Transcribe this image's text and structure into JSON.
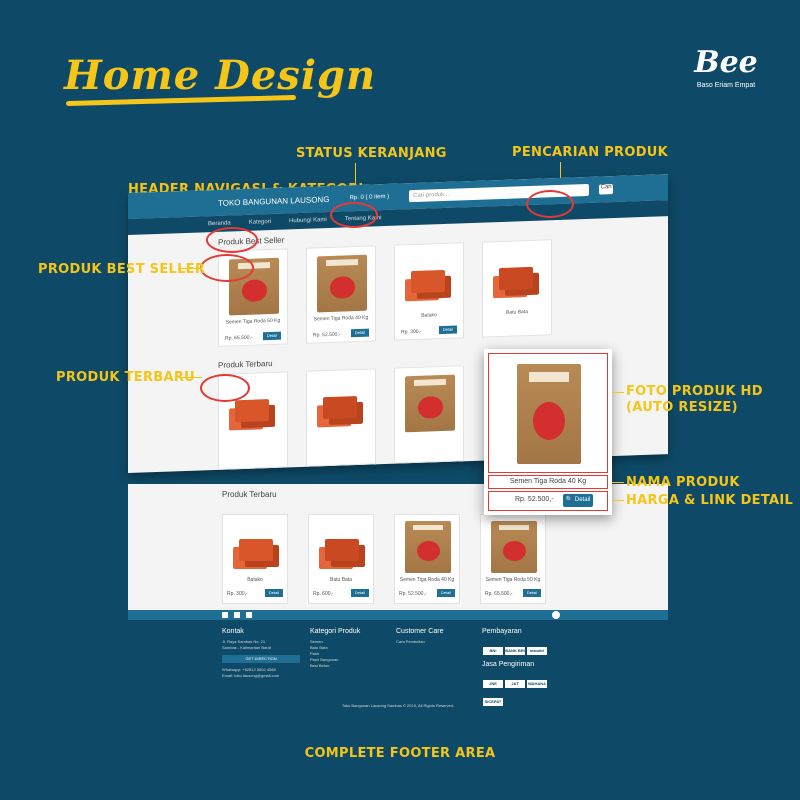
{
  "header": {
    "title": "Home Design",
    "logo_text": "Bee",
    "logo_sub": "Baso Eriam Empat"
  },
  "callouts": {
    "status_keranjang": "STATUS KERANJANG",
    "pencarian_produk": "PENCARIAN PRODUK",
    "header_navigasi": "HEADER NAVIGASI & KATEGORI",
    "produk_best_seller": "PRODUK BEST SELLER",
    "produk_terbaru": "PRODUK TERBARU",
    "foto_produk_hd": "FOTO PRODUK HD",
    "auto_resize": "(AUTO RESIZE)",
    "nama_produk": "NAMA PRODUK",
    "harga_link": "HARGA & LINK DETAIL",
    "footer_area": "COMPLETE FOOTER AREA"
  },
  "mock": {
    "store_name": "TOKO BANGUNAN LAUSONG",
    "cart": "Rp. 0 ( 0 item )",
    "search_placeholder": "Cari produk...",
    "search_button": "Cari",
    "nav": [
      "Beranda",
      "Kategori",
      "Hubungi Kami",
      "Tentang Kami"
    ],
    "best_seller_title": "Produk Best Seller",
    "terbaru_title": "Produk Terbaru",
    "best_sellers": [
      {
        "name": "Semen Tiga Roda 50 Kg",
        "price": "Rp. 65.500,-",
        "kind": "bag"
      },
      {
        "name": "Semen Tiga Roda 40 Kg",
        "price": "Rp. 52.500,-",
        "kind": "bag"
      },
      {
        "name": "Batako",
        "price": "Rp. 300,-",
        "kind": "brick"
      },
      {
        "name": "Batu Bata",
        "price": "",
        "kind": "brick"
      }
    ],
    "terbaru_cards": [
      {
        "name": "Batako",
        "price": "Rp. 300,-",
        "kind": "brick"
      },
      {
        "name": "Batu Bata",
        "price": "Rp. 600,-",
        "kind": "brick"
      },
      {
        "name": "Semen Tiga Roda 40 Kg",
        "price": "Rp. 52.500,-",
        "kind": "bag"
      },
      {
        "name": "Semen Tiga Roda 50 Kg",
        "price": "Rp. 65.500,-",
        "kind": "bag"
      }
    ],
    "detail_label": "Detail"
  },
  "zoom": {
    "name": "Semen Tiga Roda 40 Kg",
    "price": "Rp. 52.500,-",
    "detail": "Detail"
  },
  "footer": {
    "kontak_title": "Kontak",
    "address": "Jl. Raya Sambas No. 21",
    "city": "Sambas - Kalimantan Barat",
    "get_direction": "GET DIRECTION",
    "whatsapp": "Whatsapp: +62812 5602 4088",
    "email": "Email: toko.lausong@gmail.com",
    "kategori_title": "Kategori Produk",
    "kategori_items": [
      "Semen",
      "Batu Bata",
      "Pasir",
      "Pasir Bangunan",
      "Besi Beton"
    ],
    "care_title": "Customer Care",
    "care_items": [
      "Cara Pembelian"
    ],
    "pembayaran_title": "Pembayaran",
    "payments": [
      "BNI",
      "BANK BRI",
      "mandiri"
    ],
    "pengiriman_title": "Jasa Pengiriman",
    "couriers": [
      "JNE",
      "J&T",
      "WAHANA",
      "SICEPAT"
    ],
    "copyright": "Toko Bangunan Lausong Sambas © 2019, All Rights Reserved."
  },
  "colors": {
    "background": "#0e4a67",
    "accent": "#f5c518",
    "ring": "#e53935",
    "header_blue": "#1f6f95"
  }
}
